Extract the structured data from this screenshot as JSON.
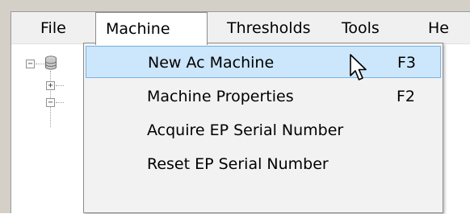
{
  "menubar": {
    "items": [
      {
        "label": "File"
      },
      {
        "label": "Machine"
      },
      {
        "label": "Thresholds"
      },
      {
        "label": "Tools"
      },
      {
        "label": "He"
      }
    ],
    "active_index": 1
  },
  "machine_menu": {
    "items": [
      {
        "label": "New Ac Machine",
        "shortcut": "F3",
        "highlighted": true
      },
      {
        "label": "Machine Properties",
        "shortcut": "F2",
        "highlighted": false
      },
      {
        "label": "Acquire EP Serial Number",
        "shortcut": "",
        "highlighted": false
      },
      {
        "label": "Reset EP Serial Number",
        "shortcut": "",
        "highlighted": false
      }
    ]
  },
  "tree": {
    "root_icon": "database-icon",
    "expander_glyphs": {
      "collapse": "−",
      "expand": "+"
    }
  },
  "colors": {
    "menu_highlight": "#cce6fb",
    "menu_highlight_border": "#7ab4e6",
    "menu_background": "#f2f2f2",
    "menubar_background": "#f0f0f0"
  }
}
